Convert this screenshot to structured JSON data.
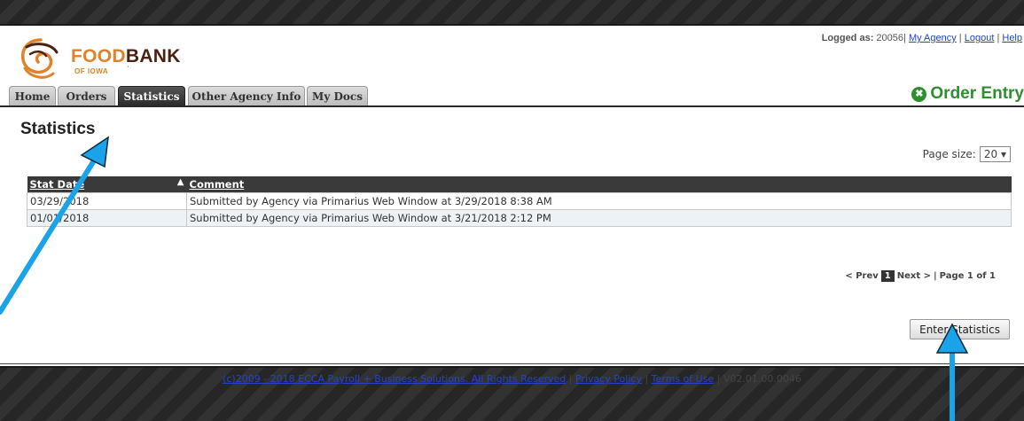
{
  "brand": {
    "food": "FOOD",
    "bank": "BANK",
    "sub": "OF IOWA"
  },
  "user_bar": {
    "label": "Logged as:",
    "user_id": "20056|",
    "links": [
      "My Agency",
      "Logout",
      "Help"
    ]
  },
  "tabs": [
    "Home",
    "Orders",
    "Statistics",
    "Other Agency Info",
    "My Docs"
  ],
  "active_tab": "Statistics",
  "order_entry": "Order Entry",
  "page_title": "Statistics",
  "page_size": {
    "label": "Page size:",
    "value": "20"
  },
  "table": {
    "columns": [
      "Stat Date",
      "Comment"
    ],
    "rows": [
      {
        "date": "03/29/2018",
        "comment": "Submitted by Agency via Primarius Web Window at 3/29/2018 8:38 AM"
      },
      {
        "date": "01/01/2018",
        "comment": "Submitted by Agency via Primarius Web Window at 3/21/2018 2:12 PM"
      }
    ]
  },
  "pager": {
    "prev": "< Prev",
    "current": "1",
    "next": "Next >",
    "sep": "|",
    "info": "Page 1 of 1"
  },
  "enter_button": "Enter Statistics",
  "footer": {
    "copyright": "(c)2009 - 2018 ECCA Payroll + Business Solutions. All Rights Reserved",
    "privacy": "Privacy Policy",
    "terms": "Terms of Use",
    "version": "V02.01.00.0046"
  },
  "colors": {
    "accent_green": "#2f8f2f",
    "annotation_arrow": "#1aa3e8",
    "brand_orange": "#e0822a",
    "brand_brown": "#4a2210"
  }
}
